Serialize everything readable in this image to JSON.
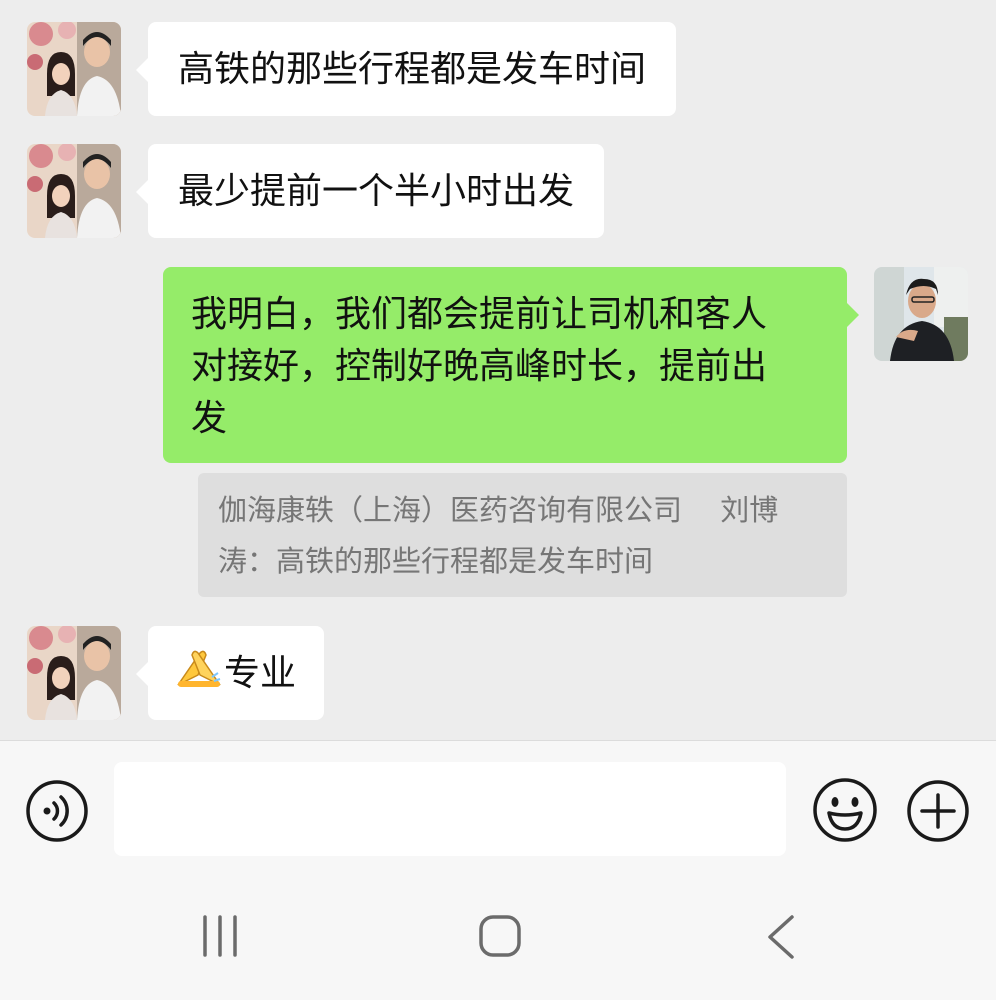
{
  "messages": [
    {
      "id": "m1",
      "side": "incoming",
      "text": "高铁的那些行程都是发车时间"
    },
    {
      "id": "m2",
      "side": "incoming",
      "text": "最少提前一个半小时出发"
    },
    {
      "id": "m3",
      "side": "outgoing",
      "lines": [
        "我明白，我们都会提前让司机和客人",
        "对接好，控制好晚高峰时长，提前出",
        "发"
      ]
    },
    {
      "id": "m4",
      "side": "incoming",
      "emoji": "folded-hands",
      "text": "专业"
    }
  ],
  "quote": {
    "lines": [
      "伽海康轶（上海）医药咨询有限公司　 刘博",
      "涛：高铁的那些行程都是发车时间"
    ]
  },
  "input": {
    "value": "",
    "placeholder": ""
  },
  "icons": {
    "voice": "voice-icon",
    "emoji": "emoji-smile-icon",
    "more": "plus-circle-icon",
    "nav_recent": "recent-apps-icon",
    "nav_home": "home-icon",
    "nav_back": "back-icon"
  },
  "colors": {
    "chat_bg": "#ededed",
    "incoming_bubble": "#ffffff",
    "outgoing_bubble": "#95ec69",
    "quote_bg": "#dedede",
    "quote_text": "#767676"
  }
}
